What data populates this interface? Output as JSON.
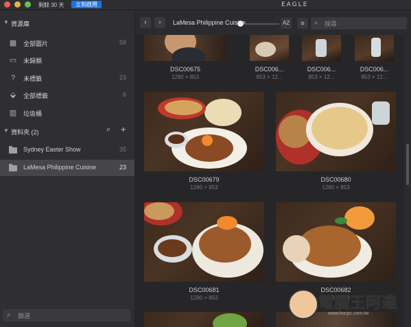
{
  "titlebar": {
    "trial_text": "剩餘 30 天",
    "buy_label": "立刻啟用",
    "app_title": "EAGLE"
  },
  "sidebar": {
    "library_header": "資源庫",
    "library_items": [
      {
        "label": "全部圖片",
        "count": "58",
        "icon": "grid-icon"
      },
      {
        "label": "未歸類",
        "count": "",
        "icon": "unsorted-icon"
      },
      {
        "label": "未標籤",
        "count": "23",
        "icon": "untagged-icon"
      },
      {
        "label": "全部標籤",
        "count": "6",
        "icon": "tag-icon"
      },
      {
        "label": "垃圾桶",
        "count": "",
        "icon": "trash-icon"
      }
    ],
    "folders_header": "資料夾 (2)",
    "folders": [
      {
        "label": "Sydney Easter Show",
        "count": "35",
        "active": false
      },
      {
        "label": "LaMesa Philippine Cuisine",
        "count": "23",
        "active": true
      }
    ],
    "filter_placeholder": "篩選"
  },
  "toolbar": {
    "breadcrumb": "LaMesa Philippine Cuisine",
    "sort_label": "AZ",
    "search_placeholder": "搜尋",
    "zoom_level": 0.05
  },
  "grid": {
    "top_row": [
      {
        "name": "DSC00675",
        "dims": "1280 × 853"
      },
      {
        "name": "DSC006...",
        "dims": "853 × 12..."
      },
      {
        "name": "DSC006...",
        "dims": "853 × 12..."
      },
      {
        "name": "DSC006...",
        "dims": "853 × 12..."
      }
    ],
    "rows": [
      {
        "name": "DSC00679",
        "dims": "1280 × 853"
      },
      {
        "name": "DSC00680",
        "dims": "1280 × 853"
      },
      {
        "name": "DSC00681",
        "dims": "1280 × 853"
      },
      {
        "name": "DSC00682",
        "dims": "1280 × 853"
      }
    ]
  },
  "watermark": {
    "text": "電腦王阿達",
    "url": "www.kocpc.com.tw"
  }
}
